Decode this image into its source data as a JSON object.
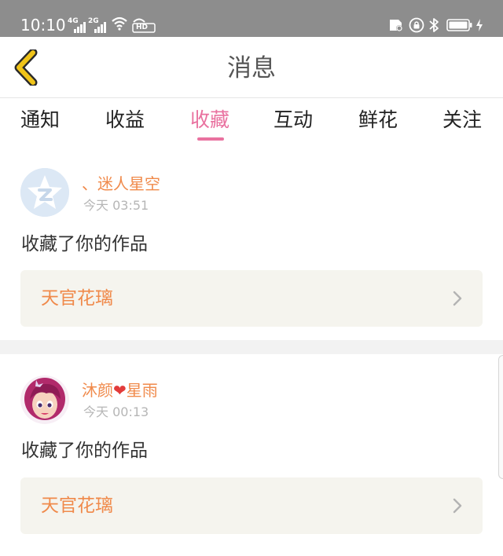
{
  "status_bar": {
    "time": "10:10",
    "net1": "4G",
    "net2": "2G",
    "hd": "HD",
    "icons": [
      "signal-icon",
      "wifi-icon",
      "hd-icon",
      "sim-card-icon",
      "lock-rotation-icon",
      "bluetooth-icon",
      "battery-icon",
      "charging-icon"
    ]
  },
  "header": {
    "title": "消息",
    "back_icon": "back-chevron-icon",
    "accent": "#f0c419"
  },
  "tabs": [
    {
      "label": "通知"
    },
    {
      "label": "收益"
    },
    {
      "label": "收藏",
      "active": true
    },
    {
      "label": "互动"
    },
    {
      "label": "鲜花"
    },
    {
      "label": "关注"
    }
  ],
  "colors": {
    "active_tab": "#e9719f",
    "username": "#f08a4b",
    "work_title": "#f08a4b",
    "card_bg": "#f5f4ee"
  },
  "messages": [
    {
      "username": "、迷人星空",
      "time": "今天 03:51",
      "action": "收藏了你的作品",
      "work_title": "天官花璃",
      "avatar": "default-star-avatar"
    },
    {
      "username": "沐颜",
      "username_suffix": "星雨",
      "heart": "❤",
      "time": "今天 00:13",
      "action": "收藏了你的作品",
      "work_title": "天官花璃",
      "avatar": "cartoon-girl-avatar"
    }
  ]
}
